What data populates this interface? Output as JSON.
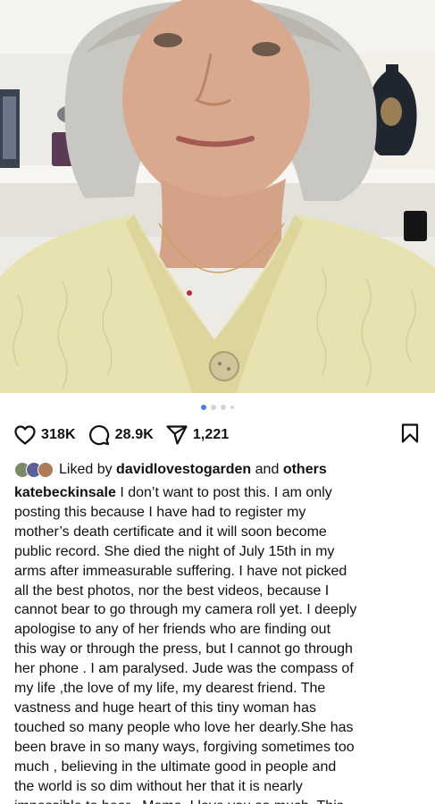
{
  "post": {
    "carousel": {
      "count": 4,
      "active_index": 0
    },
    "likes": "318K",
    "comments": "28.9K",
    "shares": "1,221"
  },
  "liked_by": {
    "prefix": "Liked by",
    "user": "davidlovestogarden",
    "connector": "and",
    "others": "others"
  },
  "caption": {
    "username": "katebeckinsale",
    "lines": [
      "I don’t want to post this. I am only",
      "posting this because I have had to register my",
      "mother’s death certificate and it will soon become",
      "public record. She died the night of July 15th  in my",
      "arms after immeasurable suffering. I have not picked",
      "all the best photos, nor the best videos, because I",
      "cannot bear to go through my camera roll yet. I deeply",
      "apologise to any of her friends who are finding out",
      "this way or through the press, but I cannot go through",
      "her phone . I am paralysed. Jude was the compass of",
      "my life ,the love of my life, my dearest friend. The",
      "vastness and huge heart  of this tiny woman has",
      "touched so many people who love her dearly.She has",
      "been brave in so many ways, forgiving sometimes too",
      "much , believing in the ultimate good in people and",
      "the world is so dim without her that it is nearly",
      "impossible to bear . Mama, I love you so much. This"
    ]
  },
  "icons": {
    "like": "heart-icon",
    "comment": "comment-bubble-icon",
    "share": "paper-plane-icon",
    "save": "bookmark-icon"
  },
  "colors": {
    "active_dot": "#3b82f6",
    "inactive_dot": "#d4d4d4",
    "text": "#111111",
    "sweater": "#e8e2b0"
  }
}
